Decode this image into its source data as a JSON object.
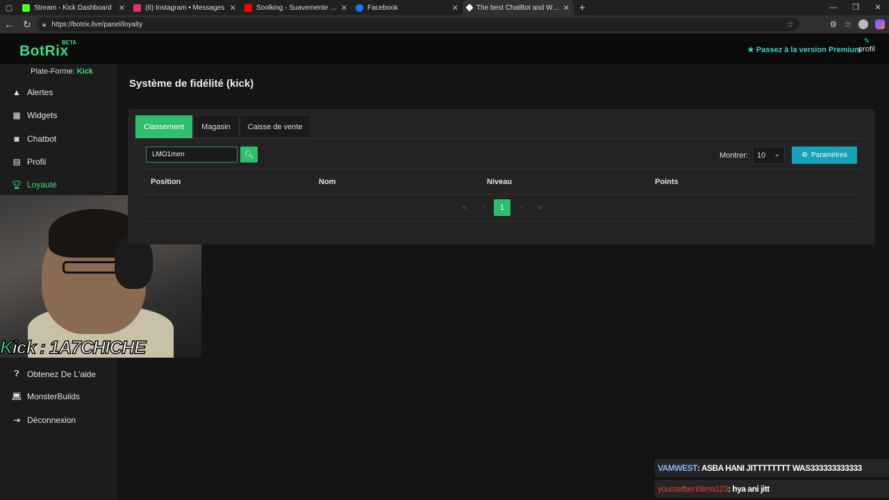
{
  "browser": {
    "tabs": [
      {
        "label": "Stream - Kick Dashboard",
        "color": "#53fc18"
      },
      {
        "label": "(6) Instagram • Messages",
        "color": "#e1306c"
      },
      {
        "label": "Soolking - Suavemente [Clip Offic",
        "color": "#ff0000"
      },
      {
        "label": "Facebook",
        "color": "#1877f2"
      },
      {
        "label": "The best ChatBot and Widgets fo",
        "color": "#ffffff"
      }
    ],
    "url": "https://botrix.live/panel/loyalty"
  },
  "header": {
    "logo": "BotRix",
    "beta": "BETA",
    "premium": "Passez à la version Premium",
    "profile": "profil"
  },
  "sidebar": {
    "platform_label": "Plate-Forme:",
    "platform_value": "Kick",
    "items": [
      {
        "label": "Alertes",
        "icon": "warning-icon"
      },
      {
        "label": "Widgets",
        "icon": "grid-icon"
      },
      {
        "label": "Chatbot",
        "icon": "robot-icon"
      },
      {
        "label": "Profil",
        "icon": "id-card-icon"
      },
      {
        "label": "Loyauté",
        "icon": "trophy-icon"
      },
      {
        "label": "Obtenez De L'aide",
        "icon": "question-icon"
      },
      {
        "label": "MonsterBuilds",
        "icon": "laptop-icon"
      },
      {
        "label": "Déconnexion",
        "icon": "logout-icon"
      }
    ]
  },
  "overlay": {
    "kick_text_k": "K",
    "kick_text_rest": "ick : 1A7CHICHE"
  },
  "main": {
    "title": "Système de fidélité (kick)",
    "tabs": [
      "Classement",
      "Magasin",
      "Caisse de vente"
    ],
    "search_value": "LMO1men",
    "show_label": "Montrer:",
    "show_value": "10",
    "params_label": "Paramètres",
    "columns": [
      "Position",
      "Nom",
      "Niveau",
      "Points"
    ],
    "pager": {
      "first": "«",
      "prev": "‹",
      "current": "1",
      "next": "›",
      "last": "»"
    }
  },
  "chat": [
    {
      "user": "VAMWEST",
      "message": " : ASBA HANI JITTTTTTTT WAS333333333333"
    },
    {
      "user": "youssefbenhlima123",
      "message": " : hya ani jitt"
    }
  ],
  "colors": {
    "accent": "#2fbf6b",
    "info": "#17a2b8",
    "premium": "#3fd1c7"
  }
}
